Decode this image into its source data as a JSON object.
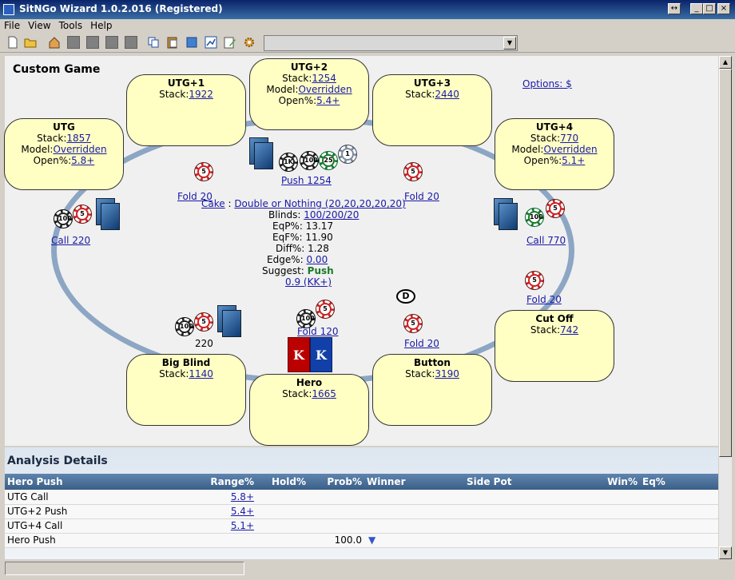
{
  "window": {
    "title": "SitNGo Wizard 1.0.2.016 (Registered)"
  },
  "menu": [
    "File",
    "View",
    "Tools",
    "Help"
  ],
  "toolbar": {
    "icons": [
      "new-icon",
      "open-icon",
      "home-icon",
      "gray-icon",
      "gray-icon",
      "gray-icon",
      "gray-icon",
      "copy-icon",
      "paste-icon",
      "export-icon",
      "chart-icon",
      "edit-icon",
      "settings-icon"
    ],
    "combo_value": ""
  },
  "main": {
    "title": "Custom Game",
    "options_label": "Options: $"
  },
  "seats": {
    "utg1": {
      "name": "UTG+1",
      "stack_label": "Stack:",
      "stack": "1922"
    },
    "utg2": {
      "name": "UTG+2",
      "stack_label": "Stack:",
      "stack": "1254",
      "model_label": "Model:",
      "model": "Overridden",
      "open_label": "Open%:",
      "open": "5.4+"
    },
    "utg3": {
      "name": "UTG+3",
      "stack_label": "Stack:",
      "stack": "2440"
    },
    "utg": {
      "name": "UTG",
      "stack_label": "Stack:",
      "stack": "1857",
      "model_label": "Model:",
      "model": "Overridden",
      "open_label": "Open%:",
      "open": "5.8+"
    },
    "utg4": {
      "name": "UTG+4",
      "stack_label": "Stack:",
      "stack": "770",
      "model_label": "Model:",
      "model": "Overridden",
      "open_label": "Open%:",
      "open": "5.1+"
    },
    "cutoff": {
      "name": "Cut Off",
      "stack_label": "Stack:",
      "stack": "742"
    },
    "bigblind": {
      "name": "Big Blind",
      "stack_label": "Stack:",
      "stack": "1140"
    },
    "hero": {
      "name": "Hero",
      "stack_label": "Stack:",
      "stack": "1665"
    },
    "button": {
      "name": "Button",
      "stack_label": "Stack:",
      "stack": "3190"
    }
  },
  "actions": {
    "utg1": "Fold 20",
    "utg2": "Push 1254",
    "utg3": "Fold 20",
    "utg": "Call 220",
    "utg4": "Call 770",
    "cutoff": "Fold 20",
    "bigblind": "220",
    "hero": "Fold 120",
    "button": "Fold 20"
  },
  "chips": {
    "c5": "5",
    "c100": "100",
    "c25": "25",
    "c1k": "1K",
    "c1": "1"
  },
  "dealer_label": "D",
  "hero_cards": [
    "K",
    "K"
  ],
  "center": {
    "cake_label": "Cake",
    "sep": " : ",
    "structure": "Double or Nothing (20,20,20,20,20)",
    "blinds_label": "Blinds:",
    "blinds": "100/200/20",
    "eqp_label": "EqP%:",
    "eqp": "13.17",
    "eqf_label": "EqF%:",
    "eqf": "11.90",
    "diff_label": "Diff%:",
    "diff": "1.28",
    "edge_label": "Edge%:",
    "edge": "0.00",
    "suggest_label": "Suggest:",
    "suggest": "Push",
    "range": "0.9 (KK+)"
  },
  "analysis": {
    "title": "Analysis Details",
    "columns": [
      "Hero Push",
      "Range%",
      "Hold%",
      "Prob%",
      "Winner",
      "Side Pot",
      "Win%",
      "Eq%"
    ],
    "rows": [
      {
        "label": "UTG Call",
        "range": "5.8+",
        "prob": ""
      },
      {
        "label": "UTG+2 Push",
        "range": "5.4+",
        "prob": ""
      },
      {
        "label": "UTG+4 Call",
        "range": "5.1+",
        "prob": ""
      },
      {
        "label": "Hero Push",
        "range": "",
        "prob": "100.0"
      }
    ]
  },
  "scroll_arrows": {
    "up": "▲",
    "down": "▼"
  },
  "title_buttons": {
    "restore": "↔",
    "min": "_",
    "max": "□",
    "close": "×"
  },
  "combo_arrow": "▼",
  "expand_arrow": "▼"
}
